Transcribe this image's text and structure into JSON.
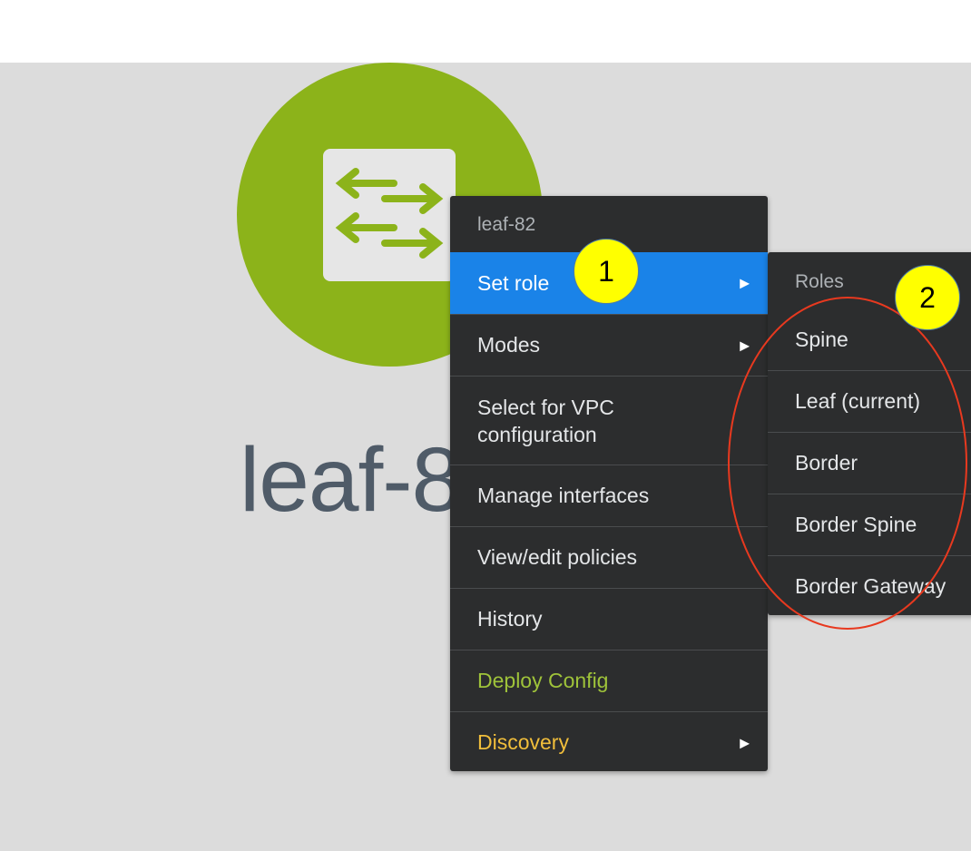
{
  "node": {
    "label": "leaf-8",
    "icon": "switch-arrows-icon",
    "color": "#8cb31a"
  },
  "context_menu": {
    "header": "leaf-82",
    "items": [
      {
        "label": "Set role",
        "submenu": true,
        "active": true
      },
      {
        "label": "Modes",
        "submenu": true
      },
      {
        "label_line1": "Select for VPC",
        "label_line2": "configuration"
      },
      {
        "label": "Manage interfaces"
      },
      {
        "label": "View/edit policies"
      },
      {
        "label": "History"
      },
      {
        "label": "Deploy Config",
        "color": "#9fc33a"
      },
      {
        "label": "Discovery",
        "submenu": true,
        "color": "#f1be3b"
      }
    ],
    "arrow_glyph": "▶",
    "active_color": "#1a83e8"
  },
  "roles_submenu": {
    "header": "Roles",
    "items": [
      {
        "label": "Spine"
      },
      {
        "label": "Leaf (current)"
      },
      {
        "label": "Border"
      },
      {
        "label": "Border Spine"
      },
      {
        "label": "Border Gateway"
      }
    ]
  },
  "annotations": {
    "callout_1": "1",
    "callout_2": "2",
    "callout_color": "#ffff00",
    "ellipse_color": "#e8391f"
  }
}
